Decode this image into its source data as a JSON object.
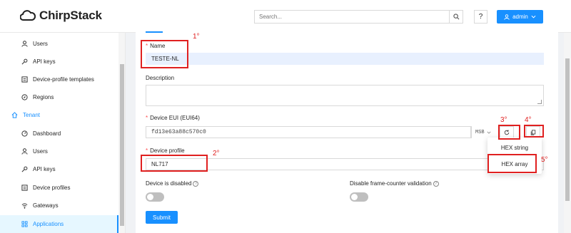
{
  "header": {
    "brand": "ChirpStack",
    "search_placeholder": "Search...",
    "help_label": "?",
    "user_label": "admin"
  },
  "sidebar": {
    "items": [
      {
        "label": "Users",
        "icon": "user-icon"
      },
      {
        "label": "API keys",
        "icon": "key-icon"
      },
      {
        "label": "Device-profile templates",
        "icon": "template-icon"
      },
      {
        "label": "Regions",
        "icon": "compass-icon"
      },
      {
        "label": "Tenant",
        "icon": "home-icon"
      },
      {
        "label": "Dashboard",
        "icon": "dashboard-icon"
      },
      {
        "label": "Users",
        "icon": "user-icon"
      },
      {
        "label": "API keys",
        "icon": "key-icon"
      },
      {
        "label": "Device profiles",
        "icon": "profile-icon"
      },
      {
        "label": "Gateways",
        "icon": "wifi-icon"
      },
      {
        "label": "Applications",
        "icon": "apps-icon"
      }
    ]
  },
  "form": {
    "name_label": "Name",
    "name_value": "TESTE-NL",
    "description_label": "Description",
    "dev_eui_label": "Device EUI (EUI64)",
    "dev_eui_value": "fd13e63a88c570c0",
    "byte_order": "MSB",
    "device_profile_label": "Device profile",
    "device_profile_value": "NL717",
    "disabled_label": "Device is disabled",
    "fcnt_label": "Disable frame-counter validation",
    "submit_label": "Submit"
  },
  "dropdown": {
    "items": [
      "HEX string",
      "HEX array"
    ]
  },
  "annotations": [
    "1°",
    "2°",
    "3°",
    "4°",
    "5°"
  ],
  "colors": {
    "accent": "#1890ff",
    "annotation": "#e02020",
    "required": "#ff4d4f"
  }
}
